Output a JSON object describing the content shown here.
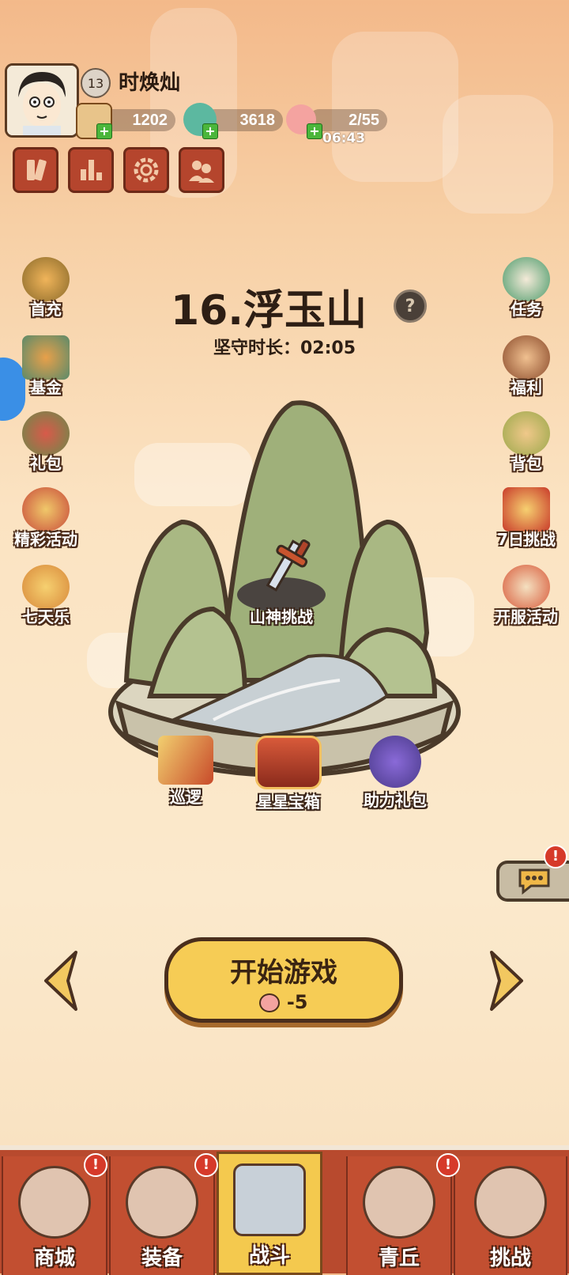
{
  "player": {
    "level": "13",
    "name": "时焕灿"
  },
  "resources": {
    "tickets": "1202",
    "jade": "3618",
    "stamina": "2/55",
    "stamina_timer": "06:43"
  },
  "side_left": [
    {
      "label": "首充",
      "icon": "first-recharge-icon"
    },
    {
      "label": "基金",
      "icon": "fund-icon"
    },
    {
      "label": "礼包",
      "icon": "gift-pack-icon"
    },
    {
      "label": "精彩活动",
      "icon": "events-icon"
    },
    {
      "label": "七天乐",
      "icon": "seven-day-icon"
    }
  ],
  "side_right": [
    {
      "label": "任务",
      "icon": "quest-scroll-icon"
    },
    {
      "label": "福利",
      "icon": "welfare-bag-icon"
    },
    {
      "label": "背包",
      "icon": "backpack-icon"
    },
    {
      "label": "7日挑战",
      "icon": "seven-day-challenge-icon"
    },
    {
      "label": "开服活动",
      "icon": "server-launch-icon"
    }
  ],
  "stage": {
    "title": "16.浮玉山",
    "duration": "坚守时长：02:05",
    "boss_label": "山神挑战"
  },
  "map_buttons": [
    {
      "label": "巡逻",
      "icon": "patrol-flag-icon"
    },
    {
      "label": "星星宝箱",
      "icon": "star-chest-icon"
    },
    {
      "label": "助力礼包",
      "icon": "support-bag-icon"
    }
  ],
  "start": {
    "label": "开始游戏",
    "cost": "-5"
  },
  "nav": [
    {
      "label": "商城",
      "alert": "!"
    },
    {
      "label": "装备",
      "alert": "!"
    },
    {
      "label": "战斗",
      "alert": ""
    },
    {
      "label": "青丘",
      "alert": "!"
    },
    {
      "label": "挑战",
      "alert": ""
    }
  ],
  "chat_alert": "!",
  "colors": {
    "nav_bg": "#b84a2e",
    "nav_active": "#f4c94e",
    "start_button": "#f6cc55",
    "tool_button": "#b5452d",
    "alert_red": "#d63a2a"
  }
}
